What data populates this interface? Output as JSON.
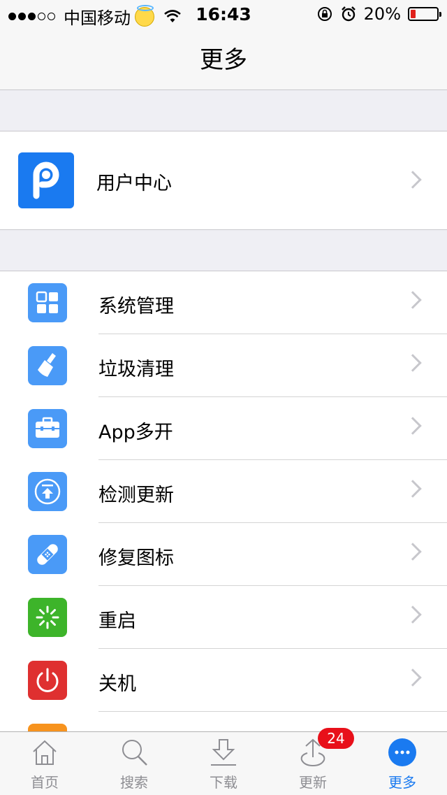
{
  "status_bar": {
    "carrier": "中国移动",
    "time": "16:43",
    "battery": "20%",
    "battery_level": 0.2,
    "signal_bars": 3,
    "signal_total": 5
  },
  "nav": {
    "title": "更多"
  },
  "user_center": {
    "label": "用户中心",
    "icon": "pp-logo-icon",
    "color": "#1a7af0"
  },
  "menu": [
    {
      "id": "system-manage",
      "label": "系统管理",
      "icon": "grid-icon",
      "color": "#4a9af7"
    },
    {
      "id": "junk-clean",
      "label": "垃圾清理",
      "icon": "broom-icon",
      "color": "#4a9af7"
    },
    {
      "id": "app-multi",
      "label": "App多开",
      "icon": "toolbox-icon",
      "color": "#4a9af7"
    },
    {
      "id": "check-update",
      "label": "检测更新",
      "icon": "upload-circle-icon",
      "color": "#4a9af7"
    },
    {
      "id": "repair-icon",
      "label": "修复图标",
      "icon": "bandage-icon",
      "color": "#4a9af7"
    },
    {
      "id": "restart",
      "label": "重启",
      "icon": "spinner-icon",
      "color": "#3db42a"
    },
    {
      "id": "shutdown",
      "label": "关机",
      "icon": "power-icon",
      "color": "#df3030"
    }
  ],
  "tabs": [
    {
      "id": "home",
      "label": "首页",
      "icon": "house-icon",
      "active": false
    },
    {
      "id": "search",
      "label": "搜索",
      "icon": "search-icon",
      "active": false
    },
    {
      "id": "download",
      "label": "下载",
      "icon": "download-icon",
      "active": false
    },
    {
      "id": "update",
      "label": "更新",
      "icon": "upload-icon",
      "active": false,
      "badge": "24"
    },
    {
      "id": "more",
      "label": "更多",
      "icon": "more-dots-icon",
      "active": true
    }
  ],
  "accent_color": "#1a7af0"
}
